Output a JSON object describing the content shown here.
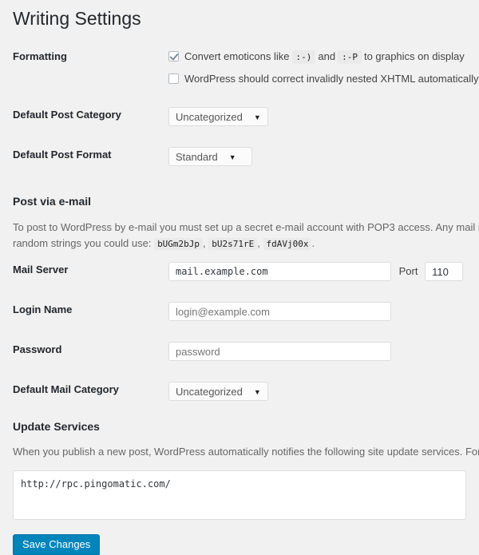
{
  "page": {
    "title": "Writing Settings",
    "background_color": "#f1f1f1"
  },
  "formatting": {
    "label": "Formatting",
    "emoticons": {
      "checked": true,
      "text_before": "Convert emoticons like",
      "code_1": ":-)",
      "text_middle": "and",
      "code_2": ":-P",
      "text_after": "to graphics on display"
    },
    "xhtml": {
      "checked": false,
      "text": "WordPress should correct invalidly nested XHTML automatically"
    }
  },
  "default_post_category": {
    "label": "Default Post Category",
    "value": "Uncategorized",
    "caret": "▼"
  },
  "default_post_format": {
    "label": "Default Post Format",
    "value": "Standard",
    "caret": "▼"
  },
  "post_via_email": {
    "heading": "Post via e-mail",
    "description_line_1": "To post to WordPress by e-mail you must set up a secret e-mail account with POP3 access. Any mail received at this addre",
    "description_line_2_prefix": "random strings you could use:",
    "random_strings": [
      "bUGm2bJp",
      "bU2s71rE",
      "fdAVj00x"
    ],
    "mail_server": {
      "label": "Mail Server",
      "value": "mail.example.com",
      "port_label": "Port",
      "port_value": "110"
    },
    "login_name": {
      "label": "Login Name",
      "placeholder": "login@example.com"
    },
    "password": {
      "label": "Password",
      "placeholder": "password"
    },
    "default_mail_category": {
      "label": "Default Mail Category",
      "value": "Uncategorized",
      "caret": "▼"
    }
  },
  "update_services": {
    "heading": "Update Services",
    "description": "When you publish a new post, WordPress automatically notifies the following site update services. For more about this,",
    "textarea_value": "http://rpc.pingomatic.com/"
  },
  "submit": {
    "save_label": "Save Changes",
    "accent_color": "#0085ba"
  }
}
